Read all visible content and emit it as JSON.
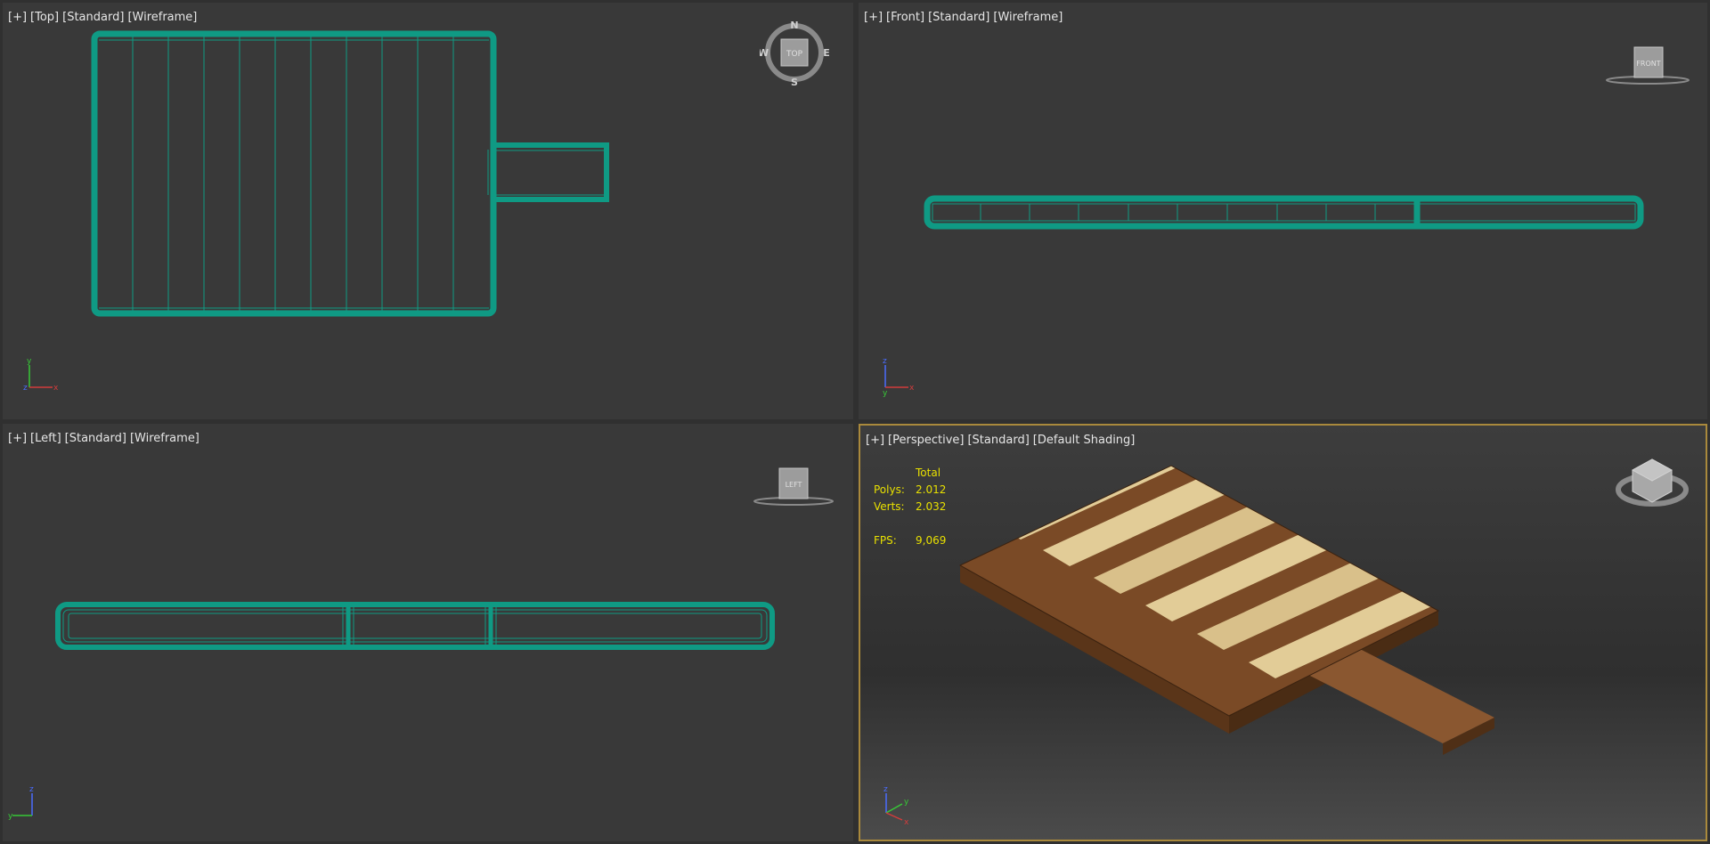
{
  "viewports": {
    "top": {
      "label": [
        "[+]",
        "[Top]",
        "[Standard]",
        "[Wireframe]"
      ],
      "navcube": {
        "face": "TOP",
        "north": "N",
        "south": "S",
        "east": "E",
        "west": "W"
      },
      "axes": {
        "a": "y",
        "b": "z",
        "c": "x"
      }
    },
    "front": {
      "label": [
        "[+]",
        "[Front]",
        "[Standard]",
        "[Wireframe]"
      ],
      "navcube": {
        "face": "FRONT"
      },
      "axes": {
        "a": "z",
        "b": "y",
        "c": "x"
      }
    },
    "left": {
      "label": [
        "[+]",
        "[Left]",
        "[Standard]",
        "[Wireframe]"
      ],
      "navcube": {
        "face": "LEFT"
      },
      "axes": {
        "a": "z",
        "b": "y"
      }
    },
    "perspective": {
      "label": [
        "[+]",
        "[Perspective]",
        "[Standard]",
        "[Default Shading]"
      ],
      "stats": {
        "header": "Total",
        "polys_label": "Polys:",
        "polys": "2.012",
        "verts_label": "Verts:",
        "verts": "2.032",
        "fps_label": "FPS:",
        "fps": "9,069"
      },
      "axes": {
        "a": "z",
        "b": "y",
        "c": "x"
      }
    }
  },
  "colors": {
    "wire": "#0f9a84",
    "active_border": "#a9893c",
    "stats": "#e8e000",
    "wood_dark": "#7a4a26",
    "wood_light": "#e2cc97"
  },
  "icons": [
    "viewcube-icon",
    "compass-ring-icon",
    "axis-tripod-icon"
  ]
}
